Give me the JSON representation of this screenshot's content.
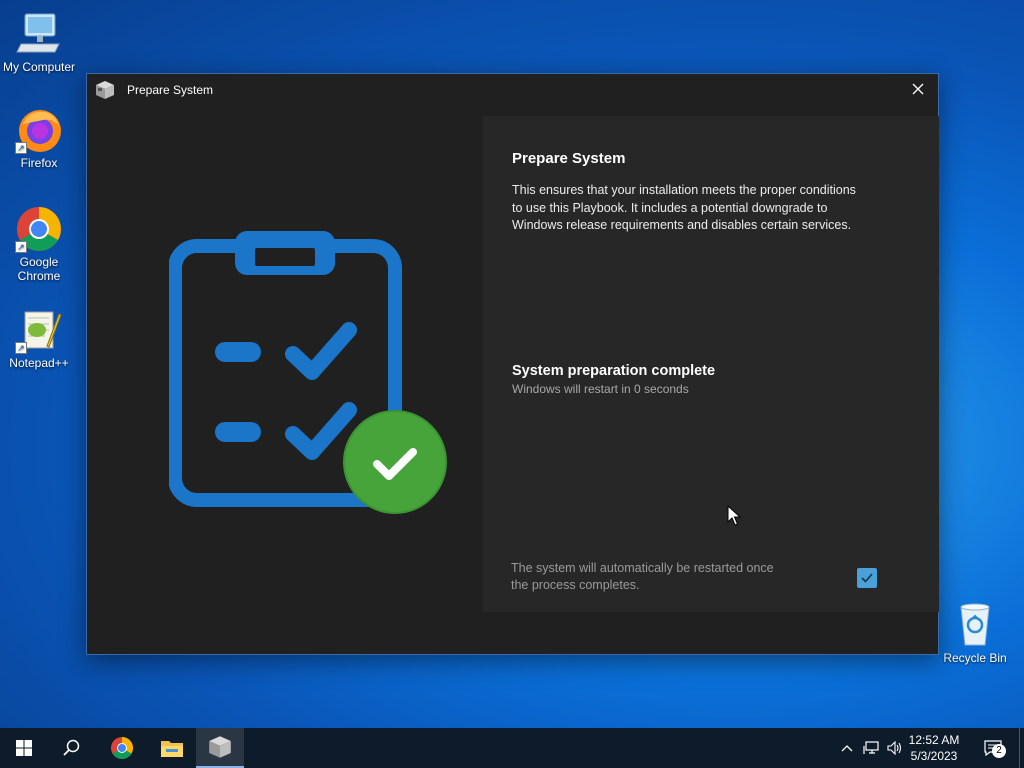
{
  "desktop": {
    "icons": [
      {
        "label": "My Computer",
        "icon": "computer-icon"
      },
      {
        "label": "Firefox",
        "icon": "firefox-icon"
      },
      {
        "label": "Google Chrome",
        "icon": "chrome-icon"
      },
      {
        "label": "Notepad++",
        "icon": "notepadpp-icon"
      },
      {
        "label": "Recycle Bin",
        "icon": "recycle-bin-icon"
      }
    ]
  },
  "window": {
    "title": "Prepare System",
    "panel": {
      "heading": "Prepare System",
      "description": "This ensures that your installation meets the proper conditions to use this Playbook. It includes a potential downgrade to Windows release requirements and disables certain services.",
      "status_title": "System preparation complete",
      "status_subtitle": "Windows will restart in 0 seconds",
      "restart_note": "The system will automatically be restarted once the process completes.",
      "restart_checked": true
    }
  },
  "taskbar": {
    "apps": [
      "start-icon",
      "search-icon",
      "chrome-icon",
      "file-explorer-icon",
      "playbook-app-icon"
    ],
    "clock_time": "12:52 AM",
    "clock_date": "5/3/2023",
    "notification_count": "2"
  },
  "colors": {
    "accent_blue": "#1b75c9",
    "success_green": "#46a43a",
    "checkbox": "#4aa1d8",
    "window_bg": "#202020",
    "panel_bg": "#272727"
  }
}
